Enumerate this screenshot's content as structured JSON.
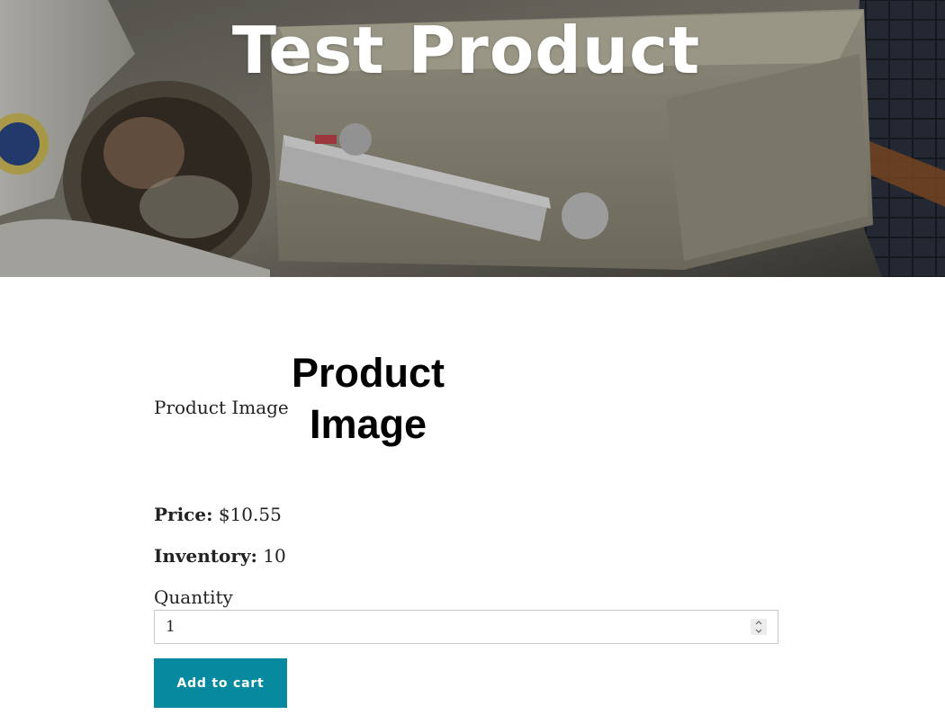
{
  "hero": {
    "title": "Test Product"
  },
  "product": {
    "image_alt": "Product Image",
    "image_placeholder": "Product Image",
    "price_label": "Price:",
    "price_value": "$10.55",
    "inventory_label": "Inventory:",
    "inventory_value": "10"
  },
  "quantity": {
    "label": "Quantity",
    "value": "1"
  },
  "actions": {
    "add_to_cart": "Add to cart"
  },
  "colors": {
    "button_bg": "#078aa0",
    "button_text": "#ffffff",
    "hero_title": "#ffffff",
    "body_text": "#222222"
  }
}
